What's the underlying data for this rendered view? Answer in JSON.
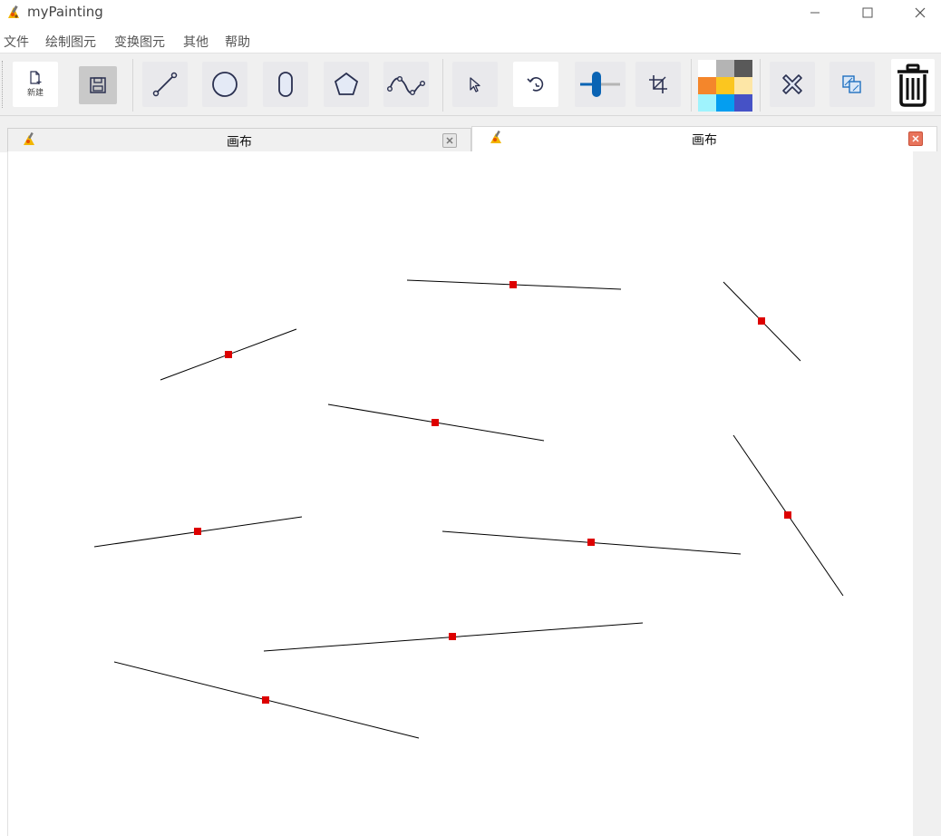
{
  "app": {
    "title": "myPainting"
  },
  "menu": [
    "文件",
    "绘制图元",
    "变换图元",
    "其他",
    "帮助"
  ],
  "toolbar": {
    "new_label": "新建",
    "palette_colors": [
      "#ffffff",
      "#b4b4b4",
      "#595959",
      "#f4862b",
      "#fbc61f",
      "#fde6a6",
      "#9ff3fd",
      "#049ef0",
      "#4652c6"
    ]
  },
  "tabs": [
    {
      "label": "画布",
      "active": false
    },
    {
      "label": "画布",
      "active": true
    }
  ],
  "icons": {
    "new": "new-file-icon",
    "save": "save-icon",
    "line": "line-tool-icon",
    "circle": "circle-tool-icon",
    "ellipse": "ellipse-tool-icon",
    "polygon": "polygon-tool-icon",
    "curve": "curve-tool-icon",
    "select": "select-cursor-icon",
    "rotate": "rotate-icon",
    "scale": "scale-slider-icon",
    "crop": "crop-icon",
    "delete": "delete-x-icon",
    "copy": "copy-layers-icon",
    "clear": "trash-icon"
  },
  "canvas": {
    "line_color": "#000000",
    "handle_color": "#dd0000"
  }
}
